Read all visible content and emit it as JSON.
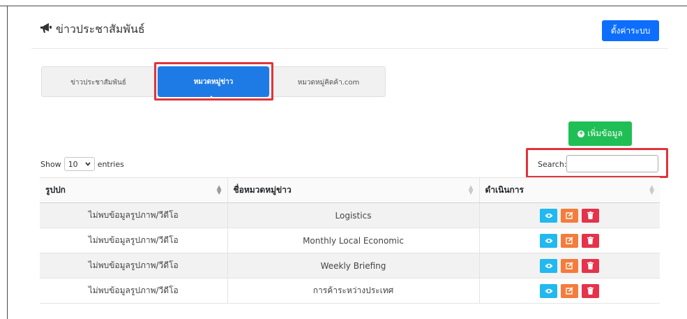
{
  "header": {
    "title": "ข่าวประชาสัมพันธ์",
    "settings_label": "ตั้งค่าระบบ",
    "icon": "megaphone-icon"
  },
  "tabs": [
    {
      "label": "ข่าวประชาสัมพันธ์",
      "active": false
    },
    {
      "label": "หมวดหมู่ข่าว",
      "active": true
    },
    {
      "label": "หมวดหมู่คิดค้า.com",
      "active": false
    }
  ],
  "add_button": {
    "label": "เพิ่มข้อมูล",
    "icon": "plus-circle-icon"
  },
  "length_control": {
    "prefix": "Show",
    "value": "10",
    "suffix": "entries"
  },
  "search": {
    "label": "Search:",
    "value": ""
  },
  "table": {
    "columns": [
      "รูปปก",
      "ชื่อหมวดหมู่ข่าว",
      "ดำเนินการ"
    ],
    "rows": [
      {
        "cover": "ไม่พบข้อมูลรูปภาพ/วีดีโอ",
        "name": "Logistics"
      },
      {
        "cover": "ไม่พบข้อมูลรูปภาพ/วีดีโอ",
        "name": "Monthly Local Economic"
      },
      {
        "cover": "ไม่พบข้อมูลรูปภาพ/วีดีโอ",
        "name": "Weekly Briefing"
      },
      {
        "cover": "ไม่พบข้อมูลรูปภาพ/วีดีโอ",
        "name": "การค้าระหว่างประเทศ"
      }
    ],
    "action_icons": [
      "eye-icon",
      "edit-icon",
      "trash-icon"
    ]
  },
  "colors": {
    "primary": "#0d6efd",
    "tab_active": "#1e7be6",
    "success": "#1fbf55",
    "view": "#22b8f0",
    "edit": "#f47c3c",
    "delete": "#e5334b",
    "highlight": "#e0343a"
  }
}
